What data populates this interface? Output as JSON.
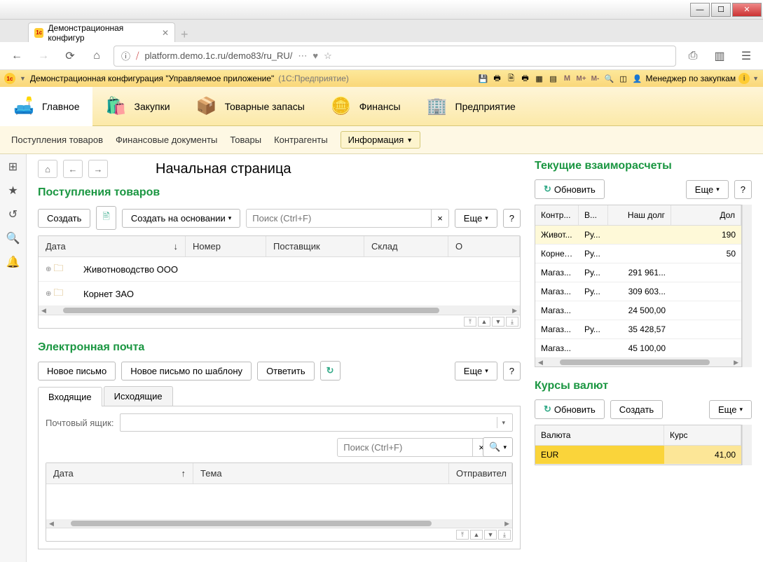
{
  "browser": {
    "tab_title": "Демонстрационная конфигур",
    "url": "platform.demo.1c.ru/demo83/ru_RU/"
  },
  "app_header": {
    "title": "Демонстрационная конфигурация \"Управляемое приложение\"",
    "product": "(1С:Предприятие)",
    "user_label": "Менеджер по закупкам",
    "m_icons": [
      "M",
      "M+",
      "M-"
    ]
  },
  "main_nav": [
    {
      "label": "Главное",
      "icon": "💡"
    },
    {
      "label": "Закупки",
      "icon": "🛍️"
    },
    {
      "label": "Товарные запасы",
      "icon": "📦"
    },
    {
      "label": "Финансы",
      "icon": "💰"
    },
    {
      "label": "Предприятие",
      "icon": "🏢"
    }
  ],
  "sub_nav": {
    "links": [
      "Поступления товаров",
      "Финансовые документы",
      "Товары",
      "Контрагенты"
    ],
    "info_btn": "Информация"
  },
  "page": {
    "title": "Начальная страница"
  },
  "receipts": {
    "title": "Поступления товаров",
    "create": "Создать",
    "create_based": "Создать на основании",
    "search_ph": "Поиск (Ctrl+F)",
    "more": "Еще",
    "cols": {
      "date": "Дата",
      "num": "Номер",
      "supplier": "Поставщик",
      "warehouse": "Склад",
      "o": "О"
    },
    "rows": [
      "Животноводство ООО",
      "Корнет ЗАО"
    ]
  },
  "email": {
    "title": "Электронная почта",
    "new_msg": "Новое письмо",
    "new_tpl": "Новое письмо по шаблону",
    "reply": "Ответить",
    "more": "Еще",
    "tab_in": "Входящие",
    "tab_out": "Исходящие",
    "mailbox": "Почтовый ящик:",
    "search_ph": "Поиск (Ctrl+F)",
    "cols": {
      "date": "Дата",
      "subject": "Тема",
      "sender": "Отправител"
    }
  },
  "settlements": {
    "title": "Текущие взаиморасчеты",
    "refresh": "Обновить",
    "more": "Еще",
    "cols": {
      "c0": "Контр...",
      "c1": "В...",
      "c2": "Наш долг",
      "c3": "Дол"
    },
    "rows": [
      {
        "c0": "Живот...",
        "c1": "Ру...",
        "c2": "",
        "c3": "190"
      },
      {
        "c0": "Корнет...",
        "c1": "Ру...",
        "c2": "",
        "c3": "50"
      },
      {
        "c0": "Магаз...",
        "c1": "Ру...",
        "c2": "291 961...",
        "c3": ""
      },
      {
        "c0": "Магаз...",
        "c1": "Ру...",
        "c2": "309 603...",
        "c3": ""
      },
      {
        "c0": "Магаз...",
        "c1": "",
        "c2": "24 500,00",
        "c3": ""
      },
      {
        "c0": "Магаз...",
        "c1": "Ру...",
        "c2": "35 428,57",
        "c3": ""
      },
      {
        "c0": "Магаз...",
        "c1": "",
        "c2": "45 100,00",
        "c3": ""
      }
    ]
  },
  "rates": {
    "title": "Курсы валют",
    "refresh": "Обновить",
    "create": "Создать",
    "more": "Еще",
    "cols": {
      "cur": "Валюта",
      "rate": "Курс"
    },
    "rows": [
      {
        "cur": "EUR",
        "rate": "41,00"
      }
    ]
  }
}
